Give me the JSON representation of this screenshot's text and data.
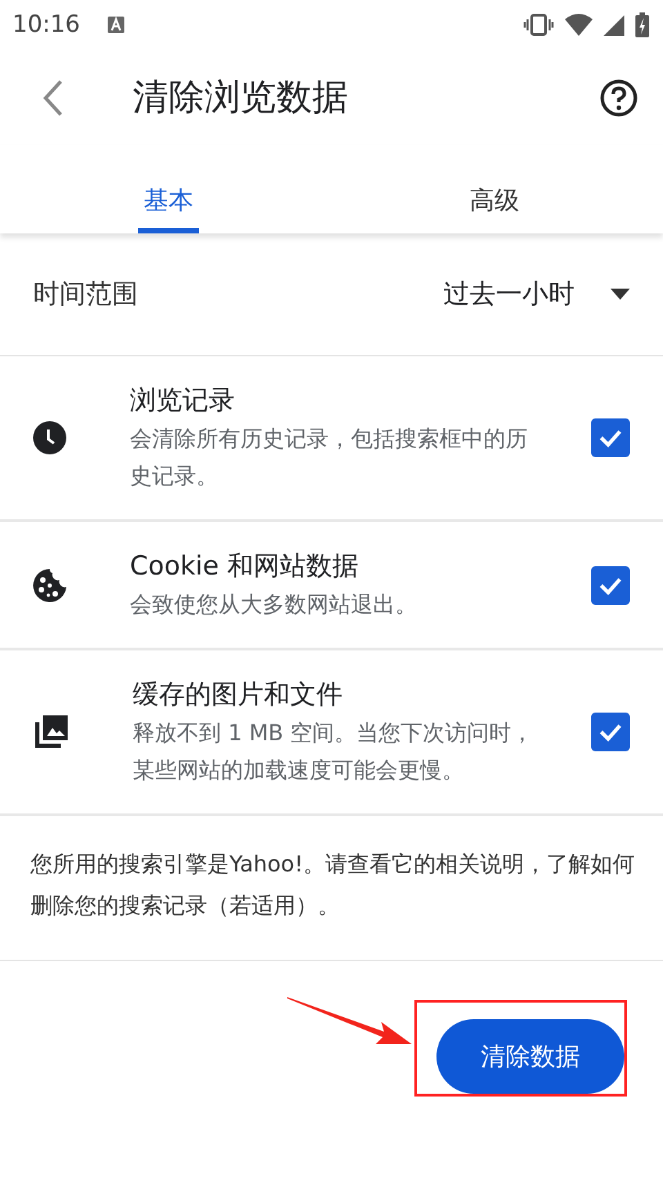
{
  "status_bar": {
    "time": "10:16"
  },
  "toolbar": {
    "title": "清除浏览数据"
  },
  "tabs": [
    {
      "label": "基本",
      "selected": true
    },
    {
      "label": "高级",
      "selected": false
    }
  ],
  "time_range": {
    "label": "时间范围",
    "value": "过去一小时"
  },
  "options": [
    {
      "kind": "history",
      "title": "浏览记录",
      "description": "会清除所有历史记录，包括搜索框中的历史记录。",
      "checked": true
    },
    {
      "kind": "cookie",
      "title": "Cookie 和网站数据",
      "description": "会致使您从大多数网站退出。",
      "checked": true
    },
    {
      "kind": "cache",
      "title": "缓存的图片和文件",
      "description": "释放不到 1 MB 空间。当您下次访问时，某些网站的加载速度可能会更慢。",
      "checked": true
    }
  ],
  "note": "您所用的搜索引擎是Yahoo!。请查看它的相关说明，了解如何删除您的搜索记录（若适用）。",
  "clear_button": {
    "label": "清除数据"
  }
}
